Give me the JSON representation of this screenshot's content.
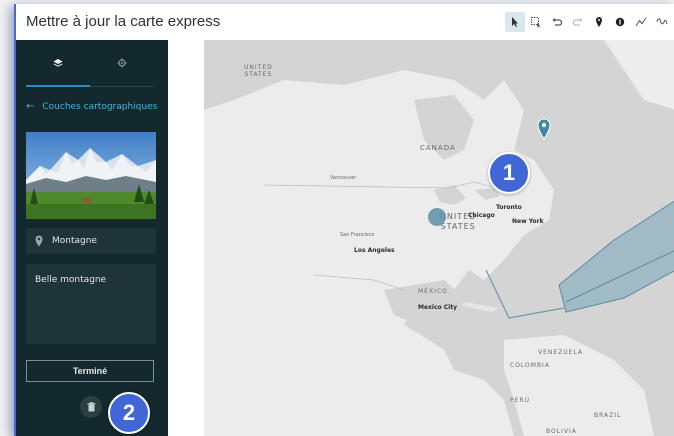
{
  "header": {
    "title": "Mettre à jour la carte express"
  },
  "toolbar": {
    "tools": [
      "pointer-icon",
      "select-box-icon",
      "undo-icon",
      "redo-icon",
      "pin-icon",
      "dot-icon",
      "line-icon",
      "freehand-icon"
    ],
    "active_tool": "pointer-icon"
  },
  "panel": {
    "tabs": [
      "layers-icon",
      "settings-icon"
    ],
    "back_label": "Couches cartographiques",
    "feature_name": "Montagne",
    "feature_description": "Belle montagne",
    "done_label": "Terminé"
  },
  "map": {
    "labels": {
      "united_states_top": "UNITED\nSTATES",
      "canada": "CANADA",
      "vancouver": "Vancouver",
      "toronto": "Toronto",
      "chicago": "Chicago",
      "new_york": "New York",
      "united_states": "UNITED\nSTATES",
      "san_francisco": "San Francisco",
      "los_angeles": "Los Angeles",
      "mexico": "MÉXICO",
      "mexico_city": "Mexico City",
      "venezuela": "VENEZUELA",
      "colombia": "COLOMBIA",
      "peru": "PERÚ",
      "brazil": "BRAZIL",
      "bolivia": "BOLIVIA"
    }
  },
  "callouts": {
    "one": "1",
    "two": "2"
  },
  "colors": {
    "accent": "#2e8bc0",
    "callout": "#4167d6",
    "panel": "#14292e",
    "marker": "#3d88a8"
  }
}
